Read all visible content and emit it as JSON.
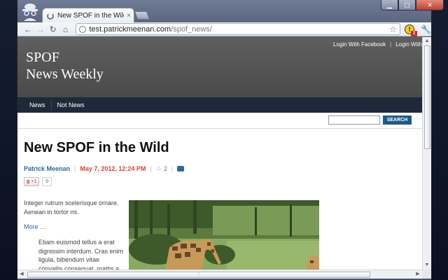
{
  "browser": {
    "tab_title": "New SPOF in the Wild - SPO",
    "tab_close": "×",
    "url_host": "test.patrickmeenan.com",
    "url_path": "/spof_news/",
    "ext_badge": "2",
    "icons": [
      "incognito-icon",
      "back-icon",
      "forward-icon",
      "reload-icon",
      "home-icon",
      "globe-icon",
      "star-icon",
      "extension-icon",
      "wrench-icon"
    ]
  },
  "site": {
    "title_line1": "SPOF",
    "title_line2": "News Weekly",
    "login_facebook": "Login With Facebook",
    "login_sep": "|",
    "login_other": "Login With",
    "nav": [
      "News",
      "Not News"
    ],
    "search_button": "SEARCH"
  },
  "article": {
    "title": "New SPOF in the Wild",
    "author": "Patrick Meenan",
    "date": "May 7, 2012, 12:24 PM",
    "comment_count": "2",
    "gplus_label": "+1",
    "gplus_count": "0",
    "intro": "Integer rutrum scelerisque ornare. Aenean in tortor mi.",
    "more": "More …",
    "body": "Etiam euismod tellus a erat dignissim interdum. Cras enim ligula, bibendum vitae convallis consequat, mattis a"
  },
  "colors": {
    "header_bg": "#555555",
    "nav_bg": "#1e2a3a",
    "link": "#2a6aa0",
    "date": "#d8442a",
    "search_button": "#1d5a8a"
  }
}
